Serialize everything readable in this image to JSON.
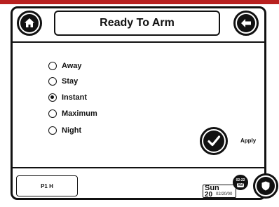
{
  "header": {
    "title": "Ready To Arm"
  },
  "icons": {
    "home": "home-icon",
    "back": "back-arrow-icon",
    "apply": "checkmark-icon",
    "emergency": "shield-icon"
  },
  "arm_modes": [
    {
      "label": "Away",
      "selected": false
    },
    {
      "label": "Stay",
      "selected": false
    },
    {
      "label": "Instant",
      "selected": true
    },
    {
      "label": "Maximum",
      "selected": false
    },
    {
      "label": "Night",
      "selected": false
    }
  ],
  "apply_label": "Apply",
  "footer": {
    "partition": "P1 H",
    "day_name": "Sun",
    "day_number": "20",
    "full_date": "02/20/00",
    "time": "02:22",
    "ampm": "AM"
  },
  "colors": {
    "accent_band": "#b8201f",
    "ink": "#111111",
    "background": "#ffffff"
  }
}
